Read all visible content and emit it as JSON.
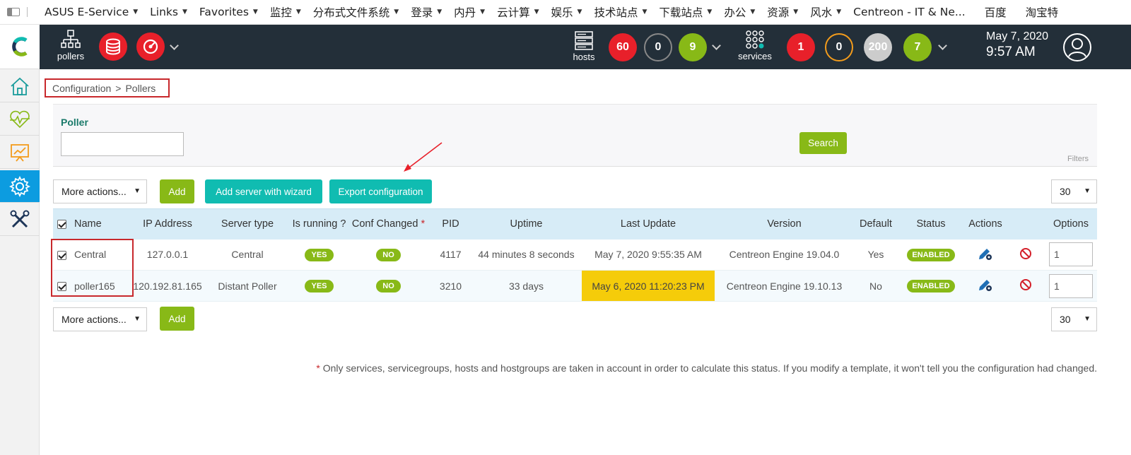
{
  "bookmarks": {
    "items": [
      {
        "label": "ASUS E-Service",
        "caret": true
      },
      {
        "label": "Links",
        "caret": true
      },
      {
        "label": "Favorites",
        "caret": true
      },
      {
        "label": "监控",
        "caret": true
      },
      {
        "label": "分布式文件系统",
        "caret": true
      },
      {
        "label": "登录",
        "caret": true
      },
      {
        "label": "内丹",
        "caret": true
      },
      {
        "label": "云计算",
        "caret": true
      },
      {
        "label": "娱乐",
        "caret": true
      },
      {
        "label": "技术站点",
        "caret": true
      },
      {
        "label": "下载站点",
        "caret": true
      },
      {
        "label": "办公",
        "caret": true
      },
      {
        "label": "资源",
        "caret": true
      },
      {
        "label": "风水",
        "caret": true
      },
      {
        "label": "Centreon - IT & Ne...",
        "caret": false
      },
      {
        "label": "百度",
        "caret": false
      },
      {
        "label": "淘宝特",
        "caret": false
      }
    ]
  },
  "topbar": {
    "pollers_label": "pollers",
    "hosts_label": "hosts",
    "host_counts": [
      "60",
      "0",
      "9"
    ],
    "services_label": "services",
    "service_counts": [
      "1",
      "0",
      "200",
      "7"
    ],
    "date": "May 7, 2020",
    "time": "9:57 AM"
  },
  "colors": {
    "header_bg": "#232f39",
    "critical": "#e8202a",
    "ok": "#88b917",
    "unknown": "#cccccc",
    "warning": "#f39c1c",
    "accent_blue": "#0c9ce0",
    "teal": "#10bcb1",
    "last_update_warning": "#f5cc0a"
  },
  "breadcrumb": {
    "root": "Configuration",
    "separator": ">",
    "current": "Pollers"
  },
  "filter": {
    "label": "Poller",
    "value": "",
    "search_button": "Search",
    "filters_label": "Filters"
  },
  "toolbar": {
    "more_actions": "More actions...",
    "add": "Add",
    "add_wizard": "Add server with wizard",
    "export": "Export configuration",
    "page_size": "30"
  },
  "table": {
    "columns": {
      "name": "Name",
      "ip": "IP Address",
      "server_type": "Server type",
      "is_running": "Is running ?",
      "conf_changed": "Conf Changed",
      "conf_changed_star": "*",
      "pid": "PID",
      "uptime": "Uptime",
      "last_update": "Last Update",
      "version": "Version",
      "default": "Default",
      "status": "Status",
      "actions": "Actions",
      "options": "Options"
    },
    "rows": [
      {
        "name": "Central",
        "ip": "127.0.0.1",
        "server_type": "Central",
        "is_running": "YES",
        "conf_changed": "NO",
        "pid": "4117",
        "uptime": "44 minutes 8 seconds",
        "last_update": "May 7, 2020 9:55:35 AM",
        "version": "Centreon Engine 19.04.0",
        "default": "Yes",
        "status": "ENABLED",
        "option": "1"
      },
      {
        "name": "poller165",
        "ip": "120.192.81.165",
        "server_type": "Distant Poller",
        "is_running": "YES",
        "conf_changed": "NO",
        "pid": "3210",
        "uptime": "33 days",
        "last_update": "May 6, 2020 11:20:23 PM",
        "version": "Centreon Engine 19.10.13",
        "default": "No",
        "status": "ENABLED",
        "option": "1"
      }
    ]
  },
  "footnote": {
    "star": "*",
    "text": "Only services, servicegroups, hosts and hostgroups are taken in account in order to calculate this status. If you modify a template, it won't tell you the configuration had changed."
  }
}
